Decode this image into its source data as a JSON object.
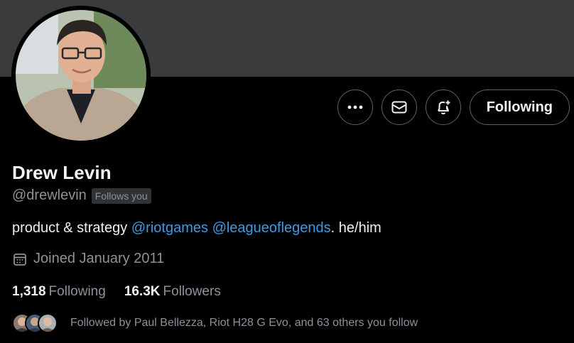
{
  "profile": {
    "name": "Drew Levin",
    "handle": "@drewlevin",
    "follows_you": "Follows you",
    "bio": {
      "prefix": "product & strategy ",
      "mention1": "@riotgames",
      "space": " ",
      "mention2": "@leagueoflegends",
      "suffix": ". he/him"
    },
    "joined": "Joined January 2011",
    "following_count": "1,318",
    "following_label": "Following",
    "followers_count": "16.3K",
    "followers_label": "Followers",
    "followed_by": "Followed by Paul Bellezza, Riot H28 G Evo, and 63 others you follow"
  },
  "actions": {
    "more_icon": "more-icon",
    "message_icon": "mail-icon",
    "notify_icon": "bell-plus-icon",
    "following_label": "Following"
  },
  "colors": {
    "background": "#000000",
    "banner": "#3a3b3d",
    "text_primary": "#e7e9ea",
    "text_secondary": "#8b9298",
    "link": "#3e9ae3",
    "border": "#5b6167"
  }
}
